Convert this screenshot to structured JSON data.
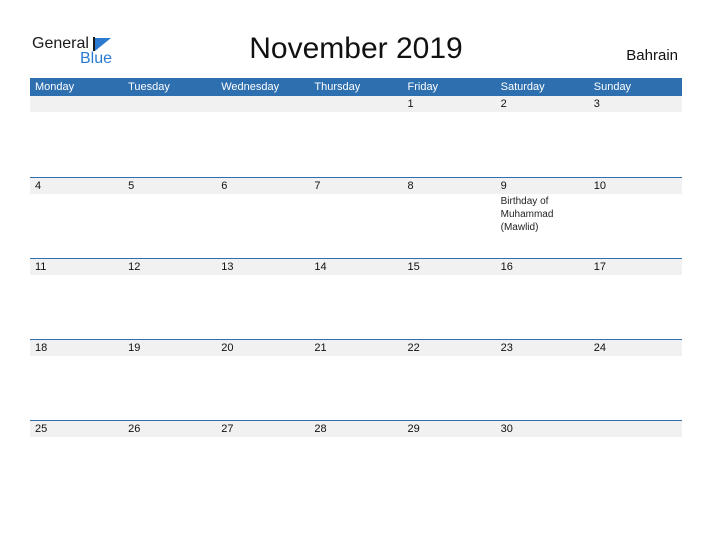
{
  "logo": {
    "word1": "General",
    "word2": "Blue"
  },
  "title": "November 2019",
  "country": "Bahrain",
  "days": [
    "Monday",
    "Tuesday",
    "Wednesday",
    "Thursday",
    "Friday",
    "Saturday",
    "Sunday"
  ],
  "weeks": [
    [
      {
        "d": ""
      },
      {
        "d": ""
      },
      {
        "d": ""
      },
      {
        "d": ""
      },
      {
        "d": "1"
      },
      {
        "d": "2"
      },
      {
        "d": "3"
      }
    ],
    [
      {
        "d": "4"
      },
      {
        "d": "5"
      },
      {
        "d": "6"
      },
      {
        "d": "7"
      },
      {
        "d": "8"
      },
      {
        "d": "9",
        "event": "Birthday of Muhammad (Mawlid)"
      },
      {
        "d": "10"
      }
    ],
    [
      {
        "d": "11"
      },
      {
        "d": "12"
      },
      {
        "d": "13"
      },
      {
        "d": "14"
      },
      {
        "d": "15"
      },
      {
        "d": "16"
      },
      {
        "d": "17"
      }
    ],
    [
      {
        "d": "18"
      },
      {
        "d": "19"
      },
      {
        "d": "20"
      },
      {
        "d": "21"
      },
      {
        "d": "22"
      },
      {
        "d": "23"
      },
      {
        "d": "24"
      }
    ],
    [
      {
        "d": "25"
      },
      {
        "d": "26"
      },
      {
        "d": "27"
      },
      {
        "d": "28"
      },
      {
        "d": "29"
      },
      {
        "d": "30"
      },
      {
        "d": ""
      }
    ]
  ]
}
